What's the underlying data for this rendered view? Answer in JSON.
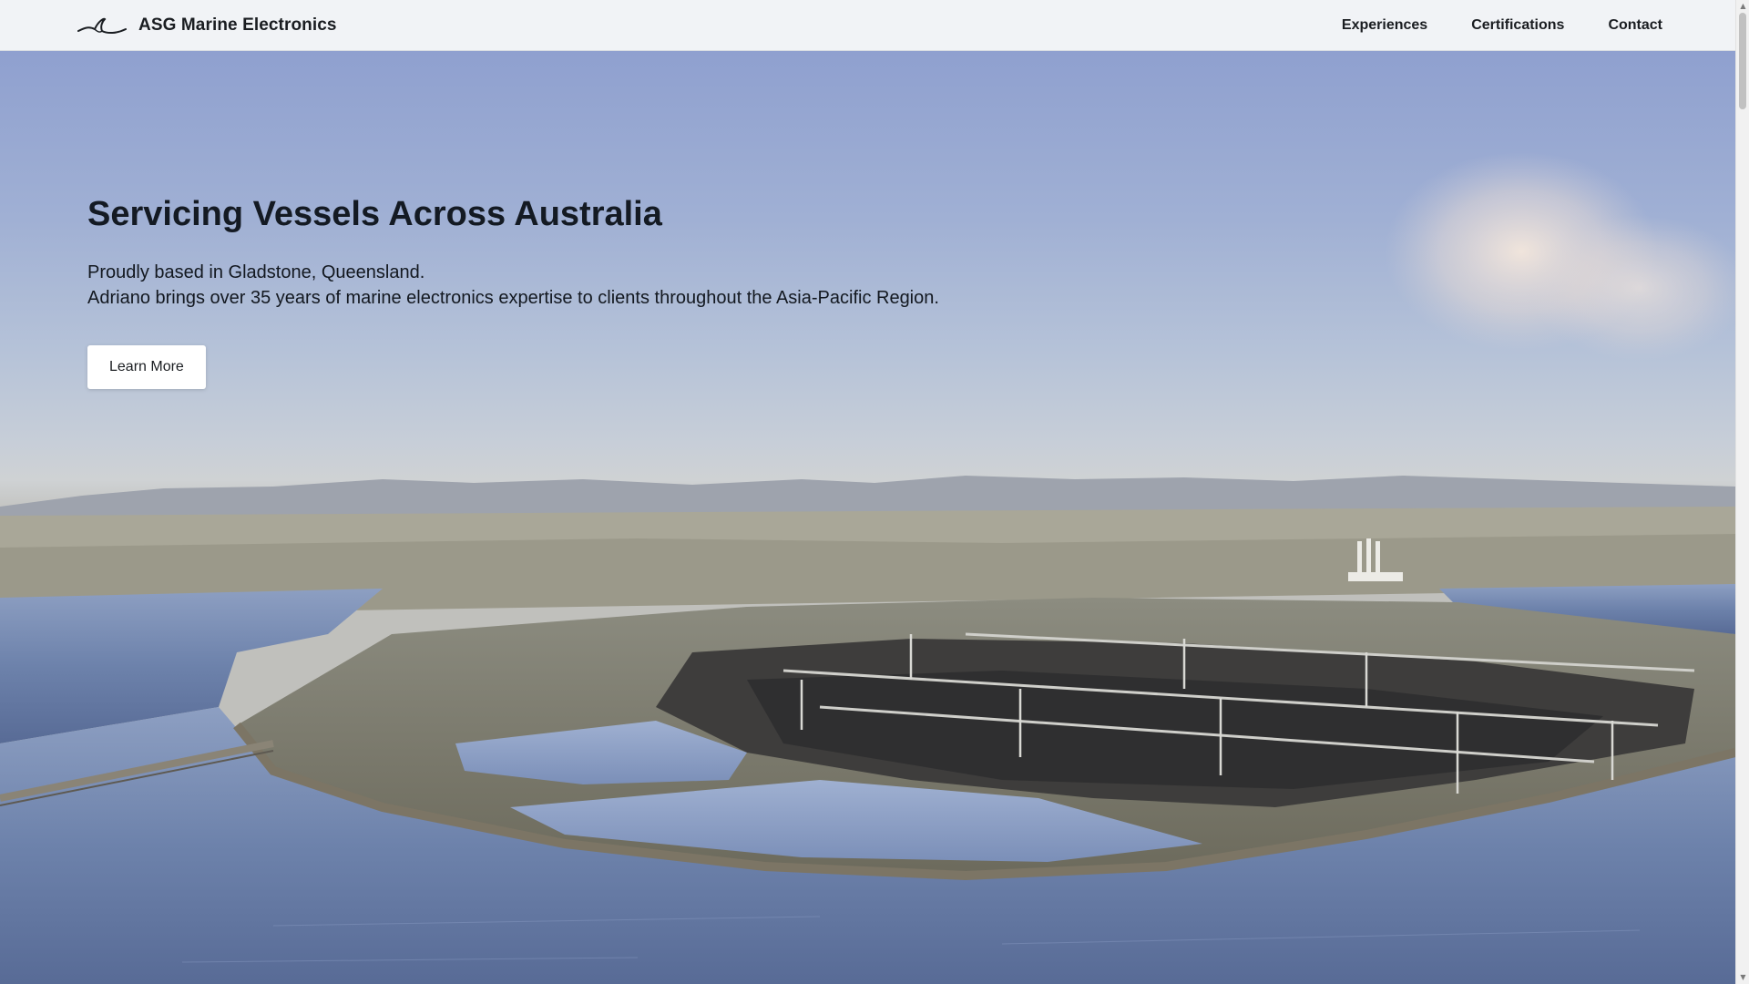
{
  "brand": {
    "name": "ASG Marine Electronics",
    "logo_icon": "wave-logo-icon"
  },
  "nav": {
    "items": [
      {
        "label": "Experiences"
      },
      {
        "label": "Certifications"
      },
      {
        "label": "Contact"
      }
    ]
  },
  "hero": {
    "title": "Servicing Vessels Across Australia",
    "line1": "Proudly based in Gladstone, Queensland.",
    "line2": "Adriano brings over 35 years of marine electronics expertise to clients throughout the Asia-Pacific Region.",
    "button_label": "Learn More",
    "background": "aerial-coal-port-harbour-photo"
  },
  "colors": {
    "nav_background": "#f1f3f6",
    "text_dark": "#141a23",
    "sky_top": "#8fa0cf",
    "water": "#6b7fa8"
  },
  "scrollbar": {
    "up_icon": "scroll-up-arrow-icon",
    "down_icon": "scroll-down-arrow-icon"
  }
}
